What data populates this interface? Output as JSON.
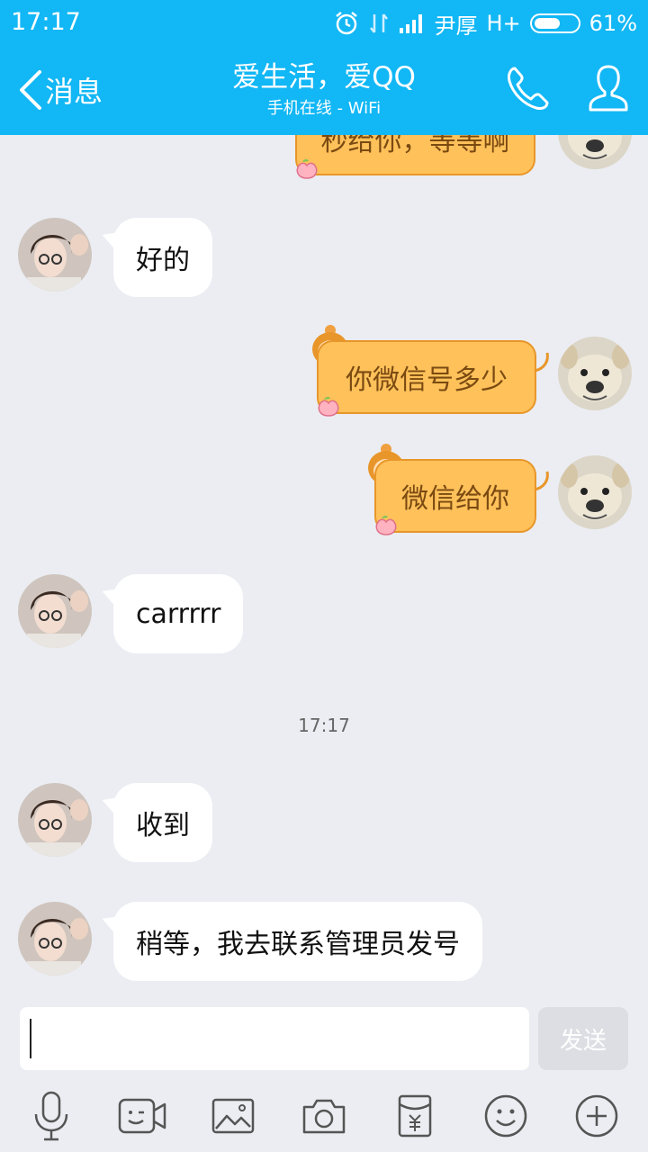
{
  "status_bar": {
    "time": "17:17",
    "carrier": "尹厚",
    "network": "H+",
    "battery_text": "61%",
    "battery_level": 0.61
  },
  "header": {
    "back_label": "消息",
    "title": "爱生活，爱QQ",
    "subtitle": "手机在线 - WiFi"
  },
  "messages": [
    {
      "side": "out",
      "text": "秒给你，等等啊"
    },
    {
      "side": "in",
      "text": "好的"
    },
    {
      "side": "out",
      "text": "你微信号多少"
    },
    {
      "side": "out",
      "text": "微信给你"
    },
    {
      "side": "in",
      "text": "carrrrr"
    },
    {
      "side": "in",
      "text": "收到"
    },
    {
      "side": "in",
      "text": "稍等，我去联系管理员发号"
    }
  ],
  "timestamp": "17:17",
  "composer": {
    "value": "",
    "send_label": "发送"
  },
  "toolbar_icons": [
    "microphone-icon",
    "video-call-icon",
    "image-icon",
    "camera-icon",
    "red-packet-icon",
    "emoji-icon",
    "plus-icon"
  ],
  "colors": {
    "header_bg": "#12b7f5",
    "chat_bg": "#ebedf2",
    "out_bubble": "#ffc15a",
    "out_bubble_border": "#e8962a",
    "in_bubble": "#ffffff"
  }
}
